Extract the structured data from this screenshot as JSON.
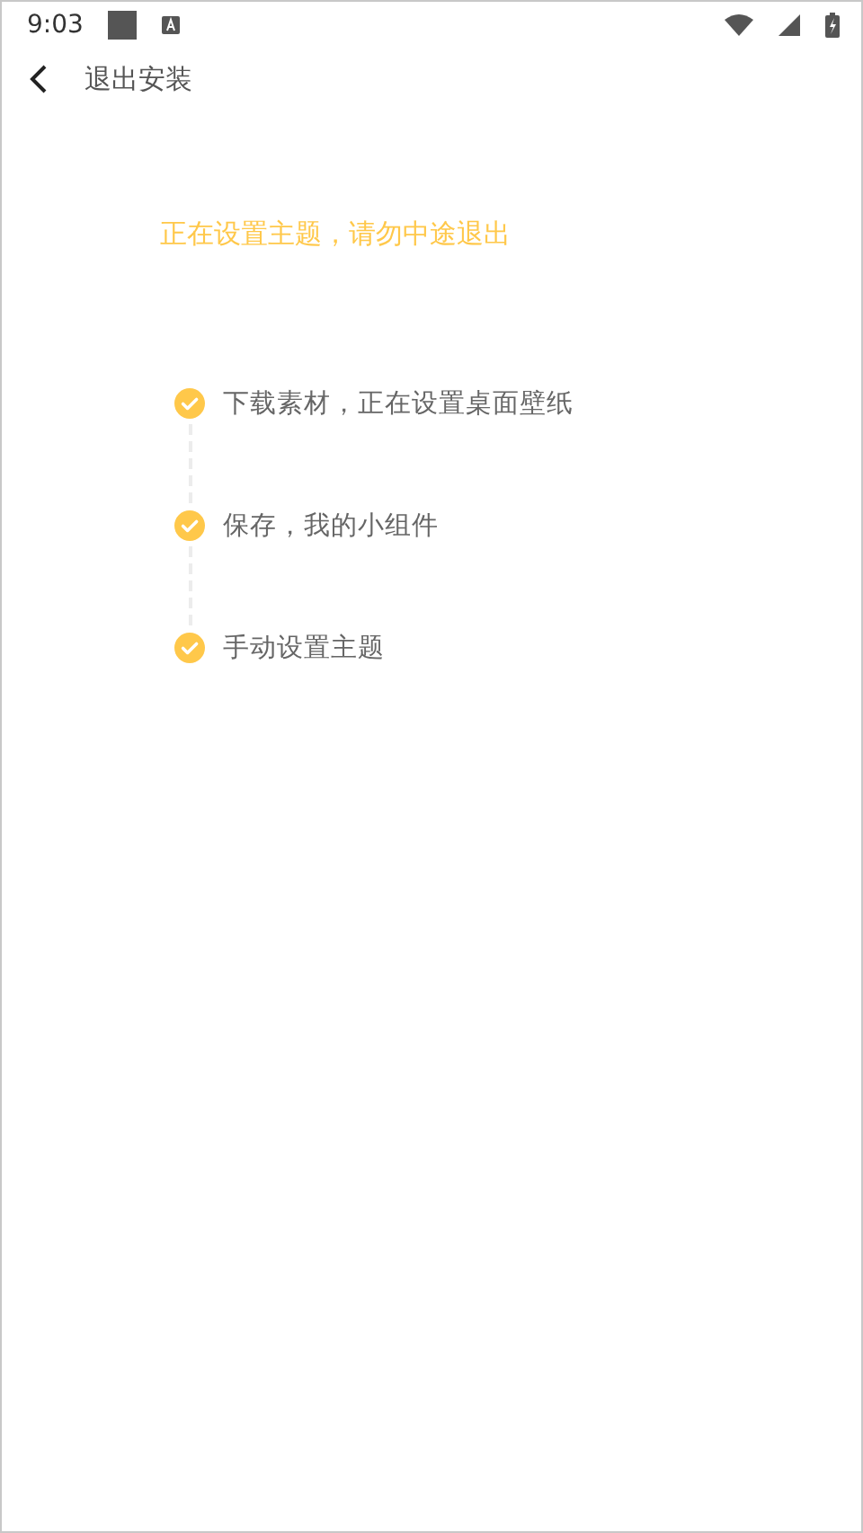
{
  "status_bar": {
    "time": "9:03"
  },
  "nav_bar": {
    "title": "退出安装"
  },
  "message": "正在设置主题，请勿中途退出",
  "steps": [
    {
      "label": "下载素材，正在设置桌面壁纸",
      "done": true
    },
    {
      "label": "保存，我的小组件",
      "done": true
    },
    {
      "label": "手动设置主题",
      "done": true
    }
  ]
}
